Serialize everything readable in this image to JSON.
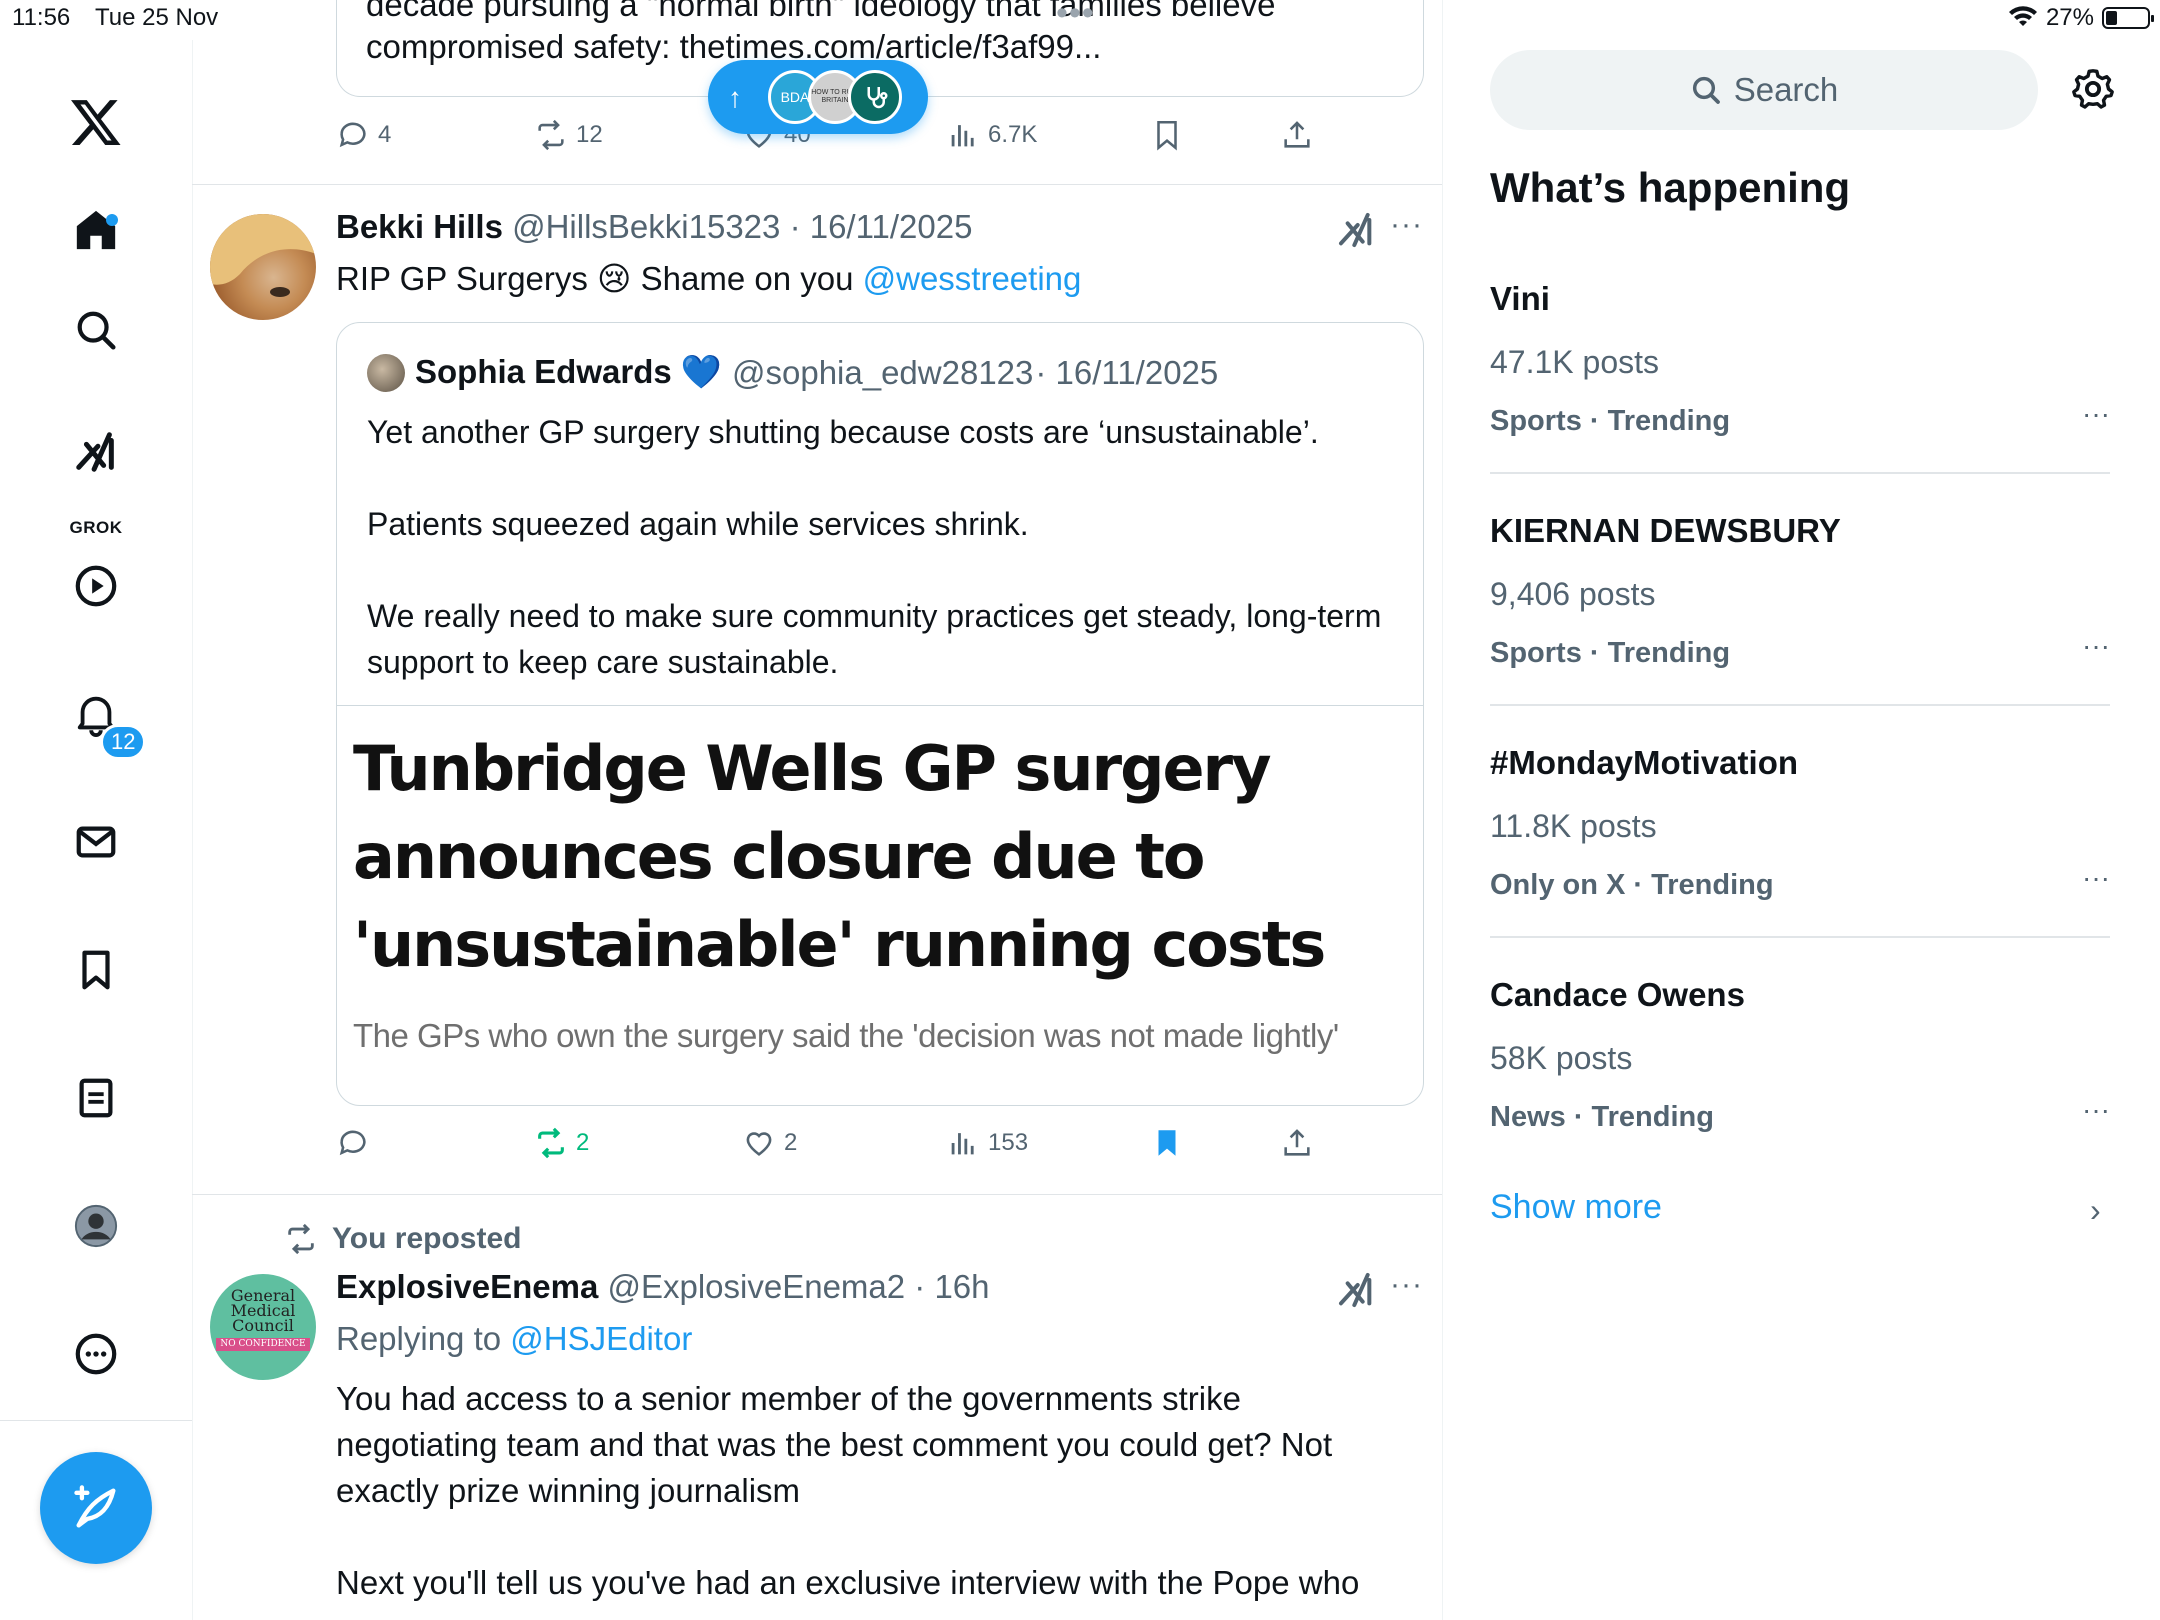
{
  "status": {
    "time": "11:56",
    "date": "Tue 25 Nov",
    "battery": "27%",
    "battery_level": 0.27
  },
  "nav": {
    "grok_label": "GROK",
    "notifications_badge": "12"
  },
  "top_tweet": {
    "card_line1": "decade pursuing a \"normal birth\" ideology that families believe",
    "card_line2": "compromised safety: thetimes.com/article/f3af99...",
    "replies": "4",
    "reposts": "12",
    "likes": "40",
    "views": "6.7K"
  },
  "new_posts_pill": {
    "avatar1": "BDA",
    "avatar2": "HOW TO RUIN BRITAIN"
  },
  "tweet1": {
    "name": "Bekki Hills",
    "handle": "@HillsBekki15323",
    "date": "· 16/11/2025",
    "text_prefix": "RIP GP Surgerys 😢  Shame on you ",
    "mention": "@wesstreeting",
    "quote": {
      "name": "Sophia Edwards 💙",
      "handle": "@sophia_edw28123",
      "date": "· 16/11/2025",
      "paragraphs": [
        "Yet another GP surgery shutting because costs are ‘unsustainable’.",
        "Patients squeezed again while services shrink.",
        "We really need to make sure community practices get steady, long-term support to keep care sustainable."
      ],
      "headline_lines": [
        "Tunbridge Wells GP surgery",
        "announces closure due to",
        "'unsustainable' running costs"
      ],
      "subline": "The GPs who own the surgery said the 'decision was not made lightly'"
    },
    "replies": "",
    "reposts": "2",
    "likes": "2",
    "views": "153"
  },
  "tweet2": {
    "repost_label": "You reposted",
    "name": "ExplosiveEnema",
    "handle": "@ExplosiveEnema2",
    "date": "· 16h",
    "replying_prefix": "Replying to ",
    "replying_mention": "@HSJEditor",
    "avatar_text": [
      "General",
      "Medical",
      "Council",
      "NO CONFIDENCE"
    ],
    "lines": [
      "You had access to a senior member of the governments strike",
      "negotiating team and that was the best comment you could get? Not",
      "exactly prize winning journalism",
      "",
      "Next you'll tell us you've had an exclusive interview with the Pope who"
    ]
  },
  "sidebar": {
    "search_placeholder": "Search",
    "title": "What’s happening",
    "trends": [
      {
        "name": "Vini",
        "posts": "47.1K posts",
        "category": "Sports · Trending"
      },
      {
        "name": "KIERNAN DEWSBURY",
        "posts": "9,406 posts",
        "category": "Sports · Trending"
      },
      {
        "name": "#MondayMotivation",
        "posts": "11.8K posts",
        "category": "Only on X · Trending"
      },
      {
        "name": "Candace Owens",
        "posts": "58K posts",
        "category": "News · Trending"
      }
    ],
    "show_more": "Show more"
  },
  "colors": {
    "accent": "#1d9bf0",
    "repost_green": "#00ba7c",
    "text": "#0f1419",
    "muted": "#536471"
  }
}
